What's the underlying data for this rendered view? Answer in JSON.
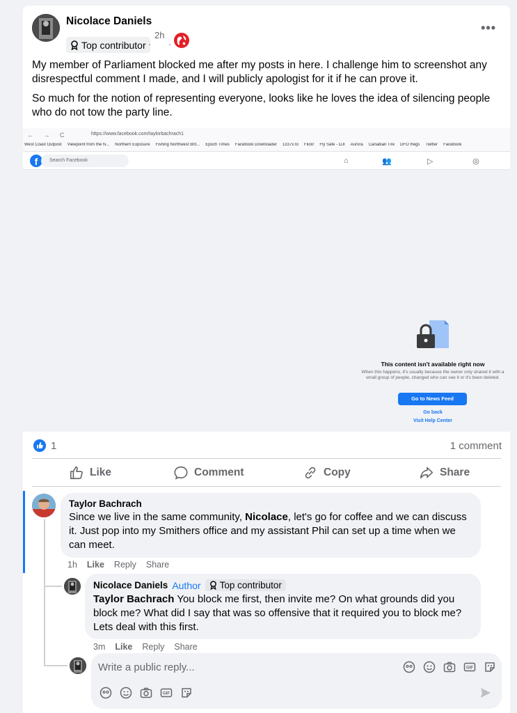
{
  "post": {
    "author": "Nicolace Daniels",
    "badge": "Top contributor",
    "time": "2h",
    "dot": "·",
    "more": "•••",
    "paragraphs": [
      "My member of Parliament blocked me after my posts in here. I challenge him to screenshot any disrespectful comment I made, and I will publicly apologist for it if he can prove it.",
      "So much for the notion of representing everyone, looks like he loves the idea of silencing people who do not tow the party line."
    ]
  },
  "screenshot": {
    "nav": "← → C",
    "url": "https://www.facebook.com/taylorbachrach1",
    "bookmarks": [
      "West Coast Outpost",
      "Viewpoint from the N...",
      "Northern Exposure",
      "Fishing Northwest Brit...",
      "Epoch Times",
      "Facebook Downloader",
      "1337x.to",
      "Flickr",
      "Fly Safe - DJI",
      "Aurora",
      "Canadian Tire",
      "DFO Regs",
      "Twitter",
      "Facebook"
    ],
    "logo": "f",
    "search_placeholder": "Search Facebook",
    "title": "This content isn't available right now",
    "desc": "When this happens, it's usually because the owner only shared it with a small group of people, changed who can see it or it's been deleted.",
    "button": "Go to News Feed",
    "go_back": "Go back",
    "help": "Visit Help Center"
  },
  "reactions": {
    "count": "1",
    "comments": "1 comment"
  },
  "actions": {
    "like": "Like",
    "comment": "Comment",
    "copy": "Copy",
    "share": "Share"
  },
  "comments": [
    {
      "name": "Taylor Bachrach",
      "text_before": "Since we live in the same community, ",
      "mention": "Nicolace",
      "text_after": ", let's go for coffee and we can discuss it. Just pop into my Smithers office and my assistant Phil can set up a time when we can meet.",
      "time": "1h",
      "like": "Like",
      "reply": "Reply",
      "share": "Share"
    },
    {
      "name": "Nicolace Daniels",
      "author_tag": "Author",
      "badge": "Top contributor",
      "mention": "Taylor Bachrach",
      "text_after": " You block me first, then invite me? On what grounds did you block me? What did I say that was so offensive that it required you to block me? Lets deal with this first.",
      "time": "3m",
      "like": "Like",
      "reply": "Reply",
      "share": "Share"
    }
  ],
  "reply_box": {
    "placeholder": "Write a public reply..."
  }
}
